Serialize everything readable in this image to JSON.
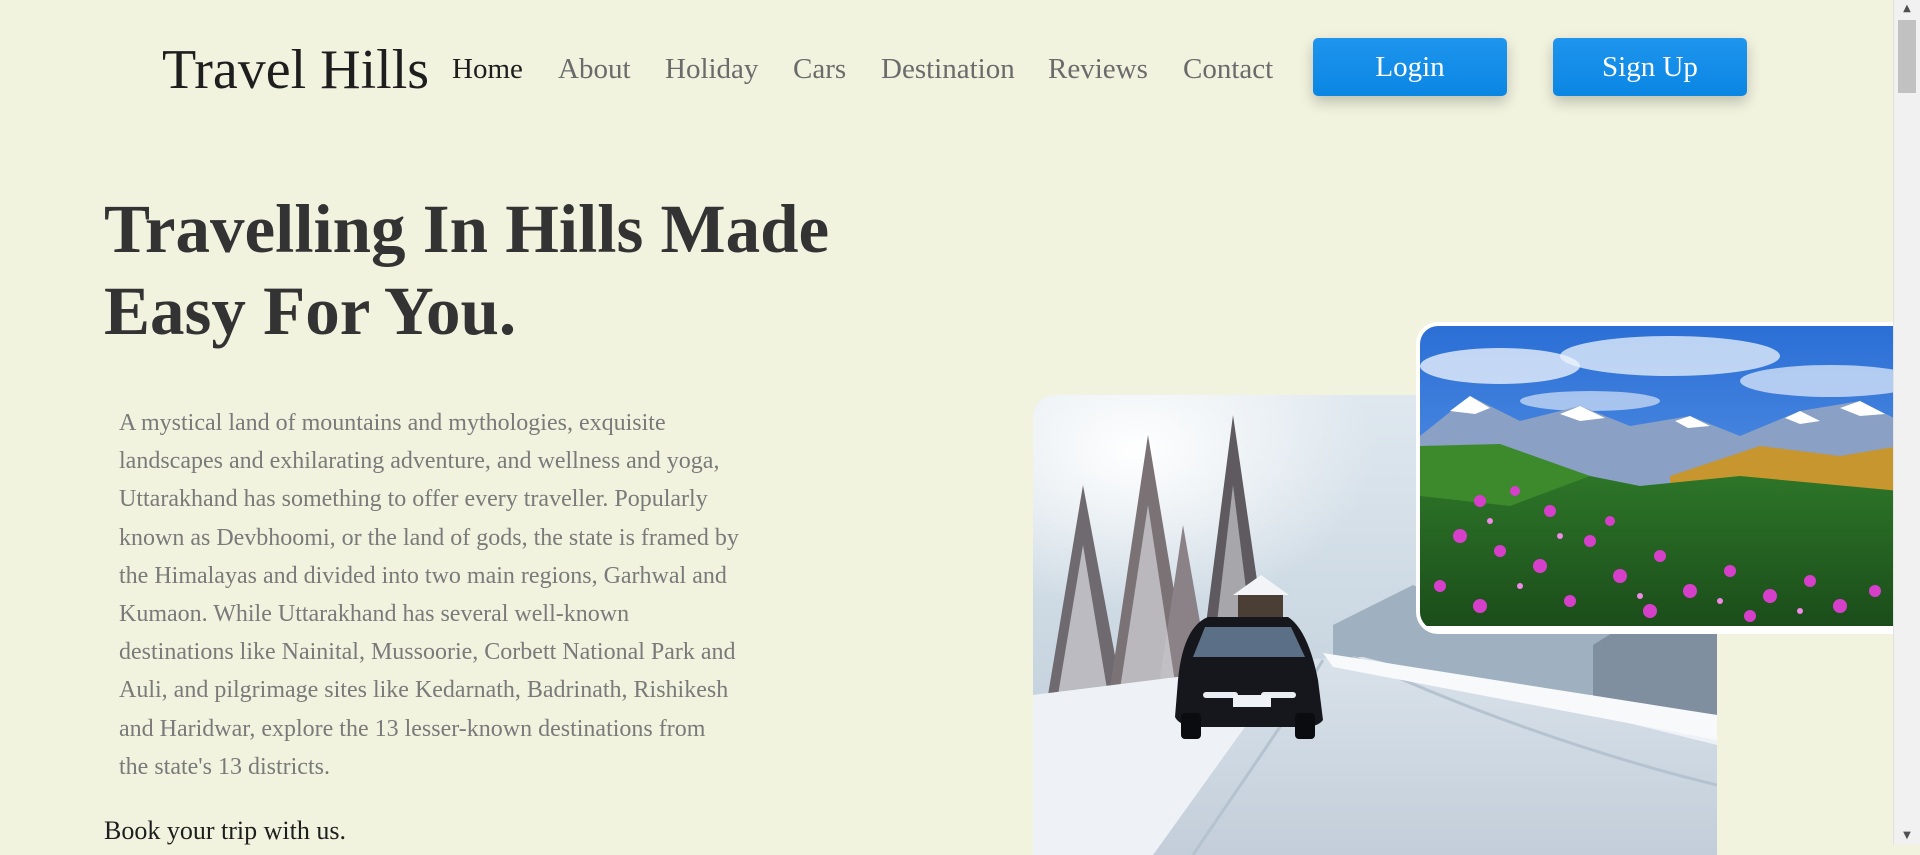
{
  "brand": {
    "name": "Travel Hills"
  },
  "nav": {
    "items": [
      {
        "label": "Home",
        "active": true
      },
      {
        "label": "About"
      },
      {
        "label": "Holiday"
      },
      {
        "label": "Cars"
      },
      {
        "label": "Destination"
      },
      {
        "label": "Reviews"
      },
      {
        "label": "Contact"
      }
    ],
    "login_label": "Login",
    "signup_label": "Sign Up"
  },
  "hero": {
    "title_line1": "Travelling In Hills Made",
    "title_line2": "Easy For You.",
    "description": "A mystical land of mountains and mythologies, exquisite landscapes and exhilarating adventure, and wellness and yoga, Uttarakhand has something to offer every traveller. Popularly known as Devbhoomi, or the land of gods, the state is framed by the Himalayas and divided into two main regions, Garhwal and Kumaon. While Uttarakhand has several well-known destinations like Nainital, Mussoorie, Corbett National Park and Auli, and pilgrimage sites like Kedarnath, Badrinath, Rishikesh and Haridwar, explore the 13 lesser-known destinations from the state's 13 districts.",
    "cta": "Book your trip with us."
  },
  "images": {
    "car": "snowy-road-car-image",
    "mountain": "mountain-meadow-flowers-image"
  },
  "colors": {
    "background": "#f1f3df",
    "button": "#0f8de8",
    "heading": "#333333",
    "body_text": "#7a7a7a"
  }
}
